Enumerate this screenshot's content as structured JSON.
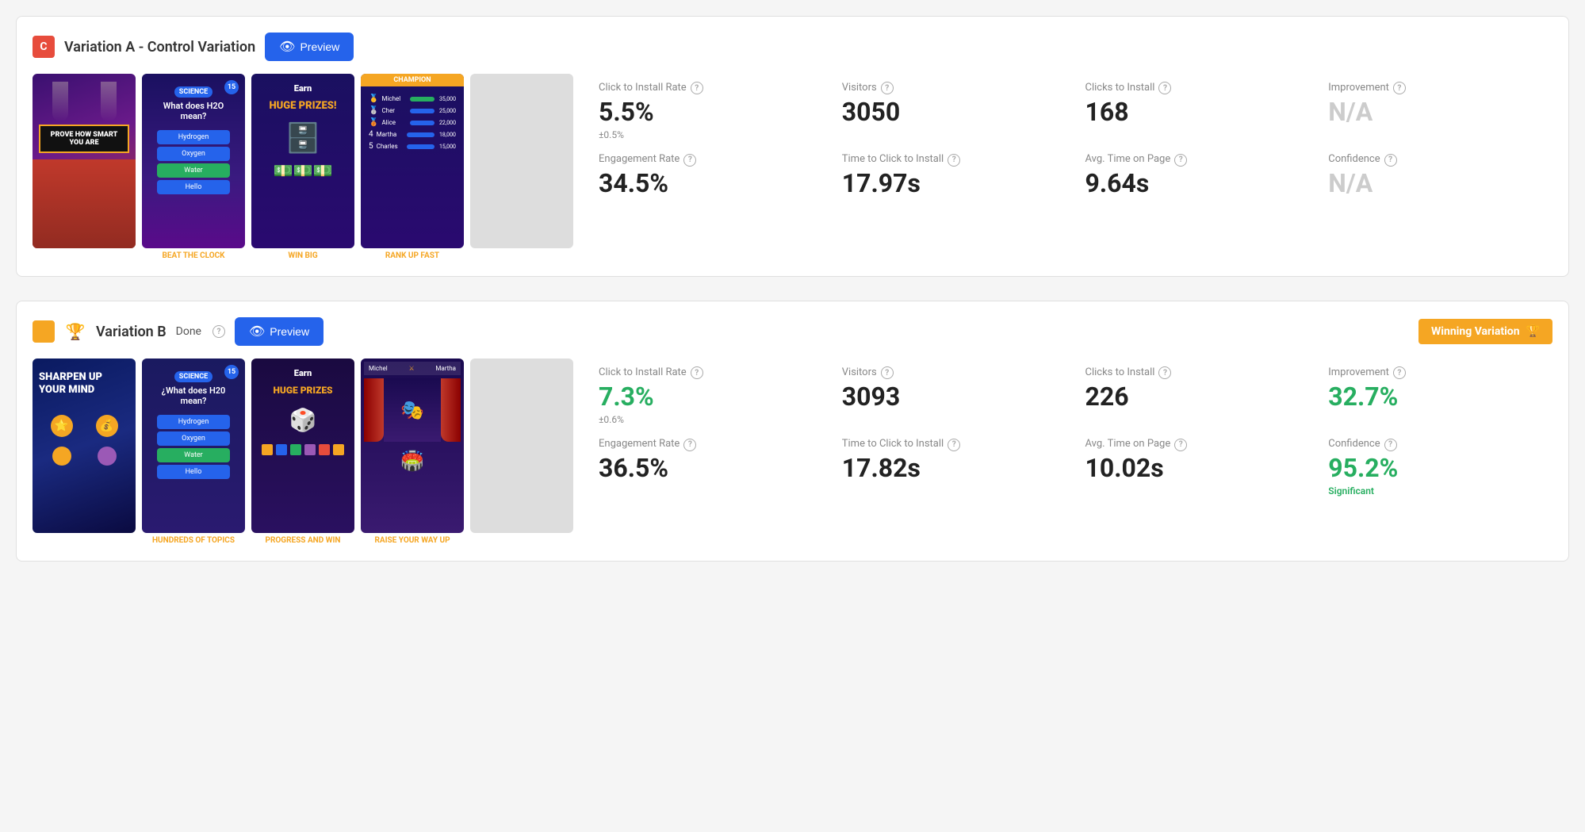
{
  "variations": [
    {
      "id": "variation-a",
      "icon_label": "C",
      "icon_type": "C",
      "title": "Variation A - Control Variation",
      "preview_label": "Preview",
      "done_label": null,
      "winning": false,
      "screenshots": [
        {
          "type": "prove",
          "label": "",
          "text": "PROVE HOW SMART YOU ARE"
        },
        {
          "type": "beat",
          "label": "BEAT THE CLOCK",
          "badge": "SCIENCE",
          "badge_num": "15",
          "question": "What does H2O mean?",
          "answers": [
            "Hydrogen",
            "Oxygen",
            "Water",
            "Hello"
          ]
        },
        {
          "type": "winbig",
          "label": "WIN BIG",
          "text": "Earn HUGE PRIZES!"
        },
        {
          "type": "rank",
          "label": "RANK UP FAST",
          "champion": "CHAMPION",
          "rows": [
            {
              "name": "Michel",
              "score": "35,000"
            },
            {
              "name": "Cher",
              "score": "25,000"
            },
            {
              "name": "Alice",
              "score": "22,000"
            },
            {
              "name": "Martha",
              "score": "18,000"
            },
            {
              "name": "Charles",
              "score": "15,000"
            }
          ]
        },
        {
          "type": "blank"
        }
      ],
      "stats": [
        {
          "label": "Click to Install Rate",
          "value": "5.5%",
          "sub": "±0.5%",
          "color": "normal"
        },
        {
          "label": "Visitors",
          "value": "3050",
          "sub": null,
          "color": "normal"
        },
        {
          "label": "Clicks to Install",
          "value": "168",
          "sub": null,
          "color": "normal"
        },
        {
          "label": "Improvement",
          "value": "N/A",
          "sub": null,
          "color": "gray"
        },
        {
          "label": "Engagement Rate",
          "value": "34.5%",
          "sub": null,
          "color": "normal"
        },
        {
          "label": "Time to Click to Install",
          "value": "17.97s",
          "sub": null,
          "color": "normal"
        },
        {
          "label": "Avg. Time on Page",
          "value": "9.64s",
          "sub": null,
          "color": "normal"
        },
        {
          "label": "Confidence",
          "value": "N/A",
          "sub": null,
          "color": "gray"
        }
      ]
    },
    {
      "id": "variation-b",
      "icon_label": "",
      "icon_type": "B",
      "title": "Variation B",
      "preview_label": "Preview",
      "done_label": "Done",
      "winning": true,
      "winning_label": "Winning Variation",
      "screenshots": [
        {
          "type": "sharpen",
          "label": "",
          "text": "SHARPEN UP Your MIND"
        },
        {
          "type": "what",
          "label": "HUNDREDS OF TOPICS",
          "badge": "SCIENCE",
          "badge_num": "15",
          "question": "¿What does H20 mean?",
          "answers": [
            "Hydrogen",
            "Oxygen",
            "Water",
            "Hello"
          ]
        },
        {
          "type": "progress",
          "label": "PROGRESS AND WIN",
          "text": "Earn HUGE PRIZES"
        },
        {
          "type": "raise",
          "label": "RAISE YOUR WAY UP",
          "vs_left": "Michel",
          "vs_right": "Martha"
        },
        {
          "type": "blank"
        }
      ],
      "stats": [
        {
          "label": "Click to Install Rate",
          "value": "7.3%",
          "sub": "±0.6%",
          "color": "green"
        },
        {
          "label": "Visitors",
          "value": "3093",
          "sub": null,
          "color": "normal"
        },
        {
          "label": "Clicks to Install",
          "value": "226",
          "sub": null,
          "color": "normal"
        },
        {
          "label": "Improvement",
          "value": "32.7%",
          "sub": null,
          "color": "green"
        },
        {
          "label": "Engagement Rate",
          "value": "36.5%",
          "sub": null,
          "color": "normal"
        },
        {
          "label": "Time to Click to Install",
          "value": "17.82s",
          "sub": null,
          "color": "normal"
        },
        {
          "label": "Avg. Time on Page",
          "value": "10.02s",
          "sub": null,
          "color": "normal"
        },
        {
          "label": "Confidence",
          "value": "95.2%",
          "sub": "Significant",
          "color": "green"
        }
      ]
    }
  ],
  "icons": {
    "eye": "👁",
    "trophy": "🏆",
    "question_mark": "?"
  }
}
